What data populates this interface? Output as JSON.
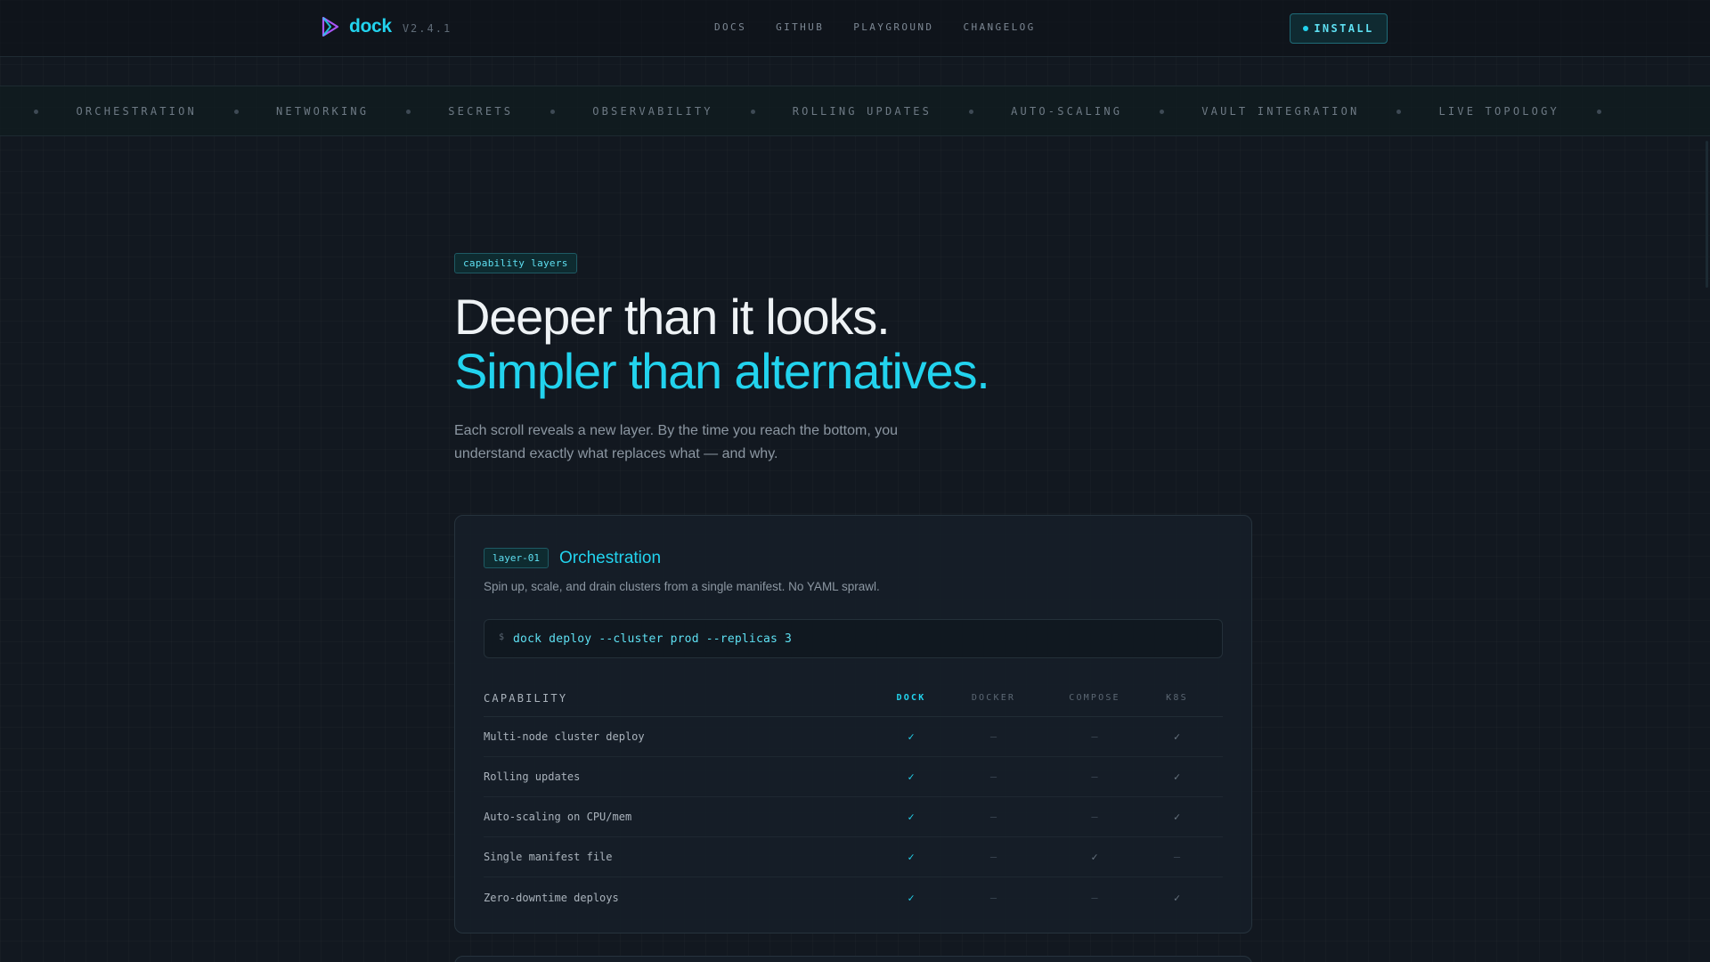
{
  "nav": {
    "brand": "dock",
    "version": "V2.4.1",
    "links": [
      "DOCS",
      "GITHUB",
      "PLAYGROUND",
      "CHANGELOG"
    ],
    "install_label": "INSTALL"
  },
  "marquee": {
    "leading": "Y",
    "items": [
      "ORCHESTRATION",
      "NETWORKING",
      "SECRETS",
      "OBSERVABILITY",
      "ROLLING UPDATES",
      "AUTO-SCALING",
      "VAULT INTEGRATION",
      "LIVE TOPOLOGY"
    ]
  },
  "hero": {
    "tag": "capability layers",
    "title_line1": "Deeper than it looks.",
    "title_line2": "Simpler than alternatives.",
    "lede": "Each scroll reveals a new layer. By the time you reach the bottom, you understand exactly what replaces what — and why."
  },
  "layer": {
    "tag": "layer-01",
    "title": "Orchestration",
    "description": "Spin up, scale, and drain clusters from a single manifest. No YAML sprawl.",
    "command_prompt": "$",
    "command": "dock deploy --cluster prod --replicas 3",
    "table": {
      "headers": [
        "CAPABILITY",
        "DOCK",
        "DOCKER",
        "COMPOSE",
        "K8S"
      ],
      "rows": [
        {
          "capability": "Multi-node cluster deploy",
          "dock": "✓",
          "docker": "—",
          "compose": "—",
          "k8s": "✓"
        },
        {
          "capability": "Rolling updates",
          "dock": "✓",
          "docker": "—",
          "compose": "—",
          "k8s": "✓"
        },
        {
          "capability": "Auto-scaling on CPU/mem",
          "dock": "✓",
          "docker": "—",
          "compose": "—",
          "k8s": "✓"
        },
        {
          "capability": "Single manifest file",
          "dock": "✓",
          "docker": "—",
          "compose": "✓",
          "k8s": "—"
        },
        {
          "capability": "Zero-downtime deploys",
          "dock": "✓",
          "docker": "—",
          "compose": "—",
          "k8s": "✓"
        }
      ]
    }
  },
  "colors": {
    "accent": "#22d3ee",
    "background": "#121820",
    "card": "#161e28"
  }
}
